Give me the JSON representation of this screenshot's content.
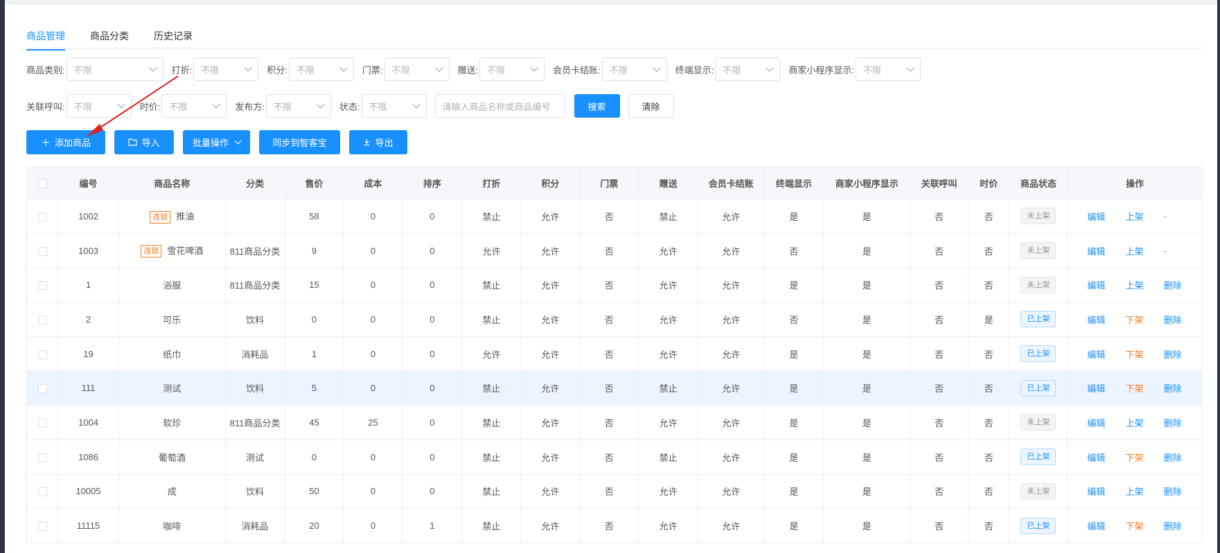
{
  "tabs": [
    "商品管理",
    "商品分类",
    "历史记录"
  ],
  "filters_row1": [
    {
      "label": "商品类别:",
      "value": "不限"
    },
    {
      "label": "打折:",
      "value": "不限"
    },
    {
      "label": "积分:",
      "value": "不限"
    },
    {
      "label": "门票:",
      "value": "不限"
    },
    {
      "label": "赠送:",
      "value": "不限"
    },
    {
      "label": "会员卡结账:",
      "value": "不限"
    },
    {
      "label": "终端显示:",
      "value": "不限"
    },
    {
      "label": "商家小程序显示:",
      "value": "不限"
    }
  ],
  "filters_row2": [
    {
      "label": "关联呼叫:",
      "value": "不限"
    },
    {
      "label": "时价:",
      "value": "不限"
    },
    {
      "label": "发布方:",
      "value": "不限"
    },
    {
      "label": "状态:",
      "value": "不限"
    }
  ],
  "search": {
    "placeholder": "请输入商品名称或商品编号",
    "search_label": "搜索",
    "clear_label": "清除"
  },
  "actions": {
    "add": "添加商品",
    "import": "导入",
    "batch": "批量操作",
    "sync": "同步到智客宝",
    "export": "导出"
  },
  "colors": {
    "primary": "#1890ff",
    "orange": "#f37b1d",
    "highlight_row": "#ecf5ff"
  },
  "table": {
    "headers": [
      "编号",
      "商品名称",
      "分类",
      "售价",
      "成本",
      "排序",
      "打折",
      "积分",
      "门票",
      "赠送",
      "会员卡结账",
      "终端显示",
      "商家小程序显示",
      "关联呼叫",
      "时价",
      "商品状态",
      "操作"
    ],
    "lock_badge": "连锁",
    "rows": [
      {
        "id": "1002",
        "name": "推油",
        "locked": true,
        "category": "",
        "price": "58",
        "cost": "0",
        "sort": "0",
        "discount": "禁止",
        "points": "允许",
        "ticket": "否",
        "gift": "禁止",
        "card": "允许",
        "terminal": "是",
        "miniapp": "是",
        "call": "否",
        "timeprice": "否",
        "status": "未上架",
        "on": false,
        "ops": [
          "编辑",
          "上架",
          "-"
        ]
      },
      {
        "id": "1003",
        "name": "雪花啤酒",
        "locked": true,
        "category": "811商品分类",
        "price": "9",
        "cost": "0",
        "sort": "0",
        "discount": "允许",
        "points": "允许",
        "ticket": "否",
        "gift": "允许",
        "card": "允许",
        "terminal": "否",
        "miniapp": "是",
        "call": "否",
        "timeprice": "否",
        "status": "未上架",
        "on": false,
        "ops": [
          "编辑",
          "上架",
          "-"
        ]
      },
      {
        "id": "1",
        "name": "浴服",
        "locked": false,
        "category": "811商品分类",
        "price": "15",
        "cost": "0",
        "sort": "0",
        "discount": "禁止",
        "points": "允许",
        "ticket": "否",
        "gift": "允许",
        "card": "允许",
        "terminal": "是",
        "miniapp": "是",
        "call": "否",
        "timeprice": "否",
        "status": "未上架",
        "on": false,
        "ops": [
          "编辑",
          "上架",
          "删除"
        ]
      },
      {
        "id": "2",
        "name": "可乐",
        "locked": false,
        "category": "饮料",
        "price": "0",
        "cost": "0",
        "sort": "0",
        "discount": "禁止",
        "points": "允许",
        "ticket": "否",
        "gift": "允许",
        "card": "允许",
        "terminal": "否",
        "miniapp": "是",
        "call": "否",
        "timeprice": "是",
        "status": "已上架",
        "on": true,
        "ops": [
          "编辑",
          "下架",
          "删除"
        ]
      },
      {
        "id": "19",
        "name": "纸巾",
        "locked": false,
        "category": "消耗品",
        "price": "1",
        "cost": "0",
        "sort": "0",
        "discount": "允许",
        "points": "允许",
        "ticket": "否",
        "gift": "允许",
        "card": "允许",
        "terminal": "是",
        "miniapp": "是",
        "call": "否",
        "timeprice": "否",
        "status": "已上架",
        "on": true,
        "ops": [
          "编辑",
          "下架",
          "删除"
        ]
      },
      {
        "id": "111",
        "name": "测试",
        "locked": false,
        "category": "饮料",
        "price": "5",
        "cost": "0",
        "sort": "0",
        "discount": "禁止",
        "points": "允许",
        "ticket": "否",
        "gift": "禁止",
        "card": "允许",
        "terminal": "是",
        "miniapp": "是",
        "call": "否",
        "timeprice": "否",
        "status": "已上架",
        "on": true,
        "ops": [
          "编辑",
          "下架",
          "删除"
        ],
        "highlight": true
      },
      {
        "id": "1004",
        "name": "软珍",
        "locked": false,
        "category": "811商品分类",
        "price": "45",
        "cost": "25",
        "sort": "0",
        "discount": "禁止",
        "points": "允许",
        "ticket": "否",
        "gift": "允许",
        "card": "允许",
        "terminal": "是",
        "miniapp": "是",
        "call": "否",
        "timeprice": "否",
        "status": "未上架",
        "on": false,
        "ops": [
          "编辑",
          "上架",
          "删除"
        ]
      },
      {
        "id": "1086",
        "name": "葡萄酒",
        "locked": false,
        "category": "测试",
        "price": "0",
        "cost": "0",
        "sort": "0",
        "discount": "禁止",
        "points": "允许",
        "ticket": "否",
        "gift": "禁止",
        "card": "允许",
        "terminal": "是",
        "miniapp": "是",
        "call": "否",
        "timeprice": "否",
        "status": "已上架",
        "on": true,
        "ops": [
          "编辑",
          "下架",
          "删除"
        ]
      },
      {
        "id": "10005",
        "name": "成",
        "locked": false,
        "category": "饮料",
        "price": "50",
        "cost": "0",
        "sort": "0",
        "discount": "禁止",
        "points": "允许",
        "ticket": "否",
        "gift": "允许",
        "card": "允许",
        "terminal": "是",
        "miniapp": "是",
        "call": "否",
        "timeprice": "否",
        "status": "未上架",
        "on": false,
        "ops": [
          "编辑",
          "上架",
          "删除"
        ]
      },
      {
        "id": "11115",
        "name": "咖啡",
        "locked": false,
        "category": "消耗品",
        "price": "20",
        "cost": "0",
        "sort": "1",
        "discount": "禁止",
        "points": "允许",
        "ticket": "否",
        "gift": "允许",
        "card": "允许",
        "terminal": "是",
        "miniapp": "是",
        "call": "否",
        "timeprice": "否",
        "status": "已上架",
        "on": true,
        "ops": [
          "编辑",
          "下架",
          "删除"
        ]
      }
    ]
  }
}
